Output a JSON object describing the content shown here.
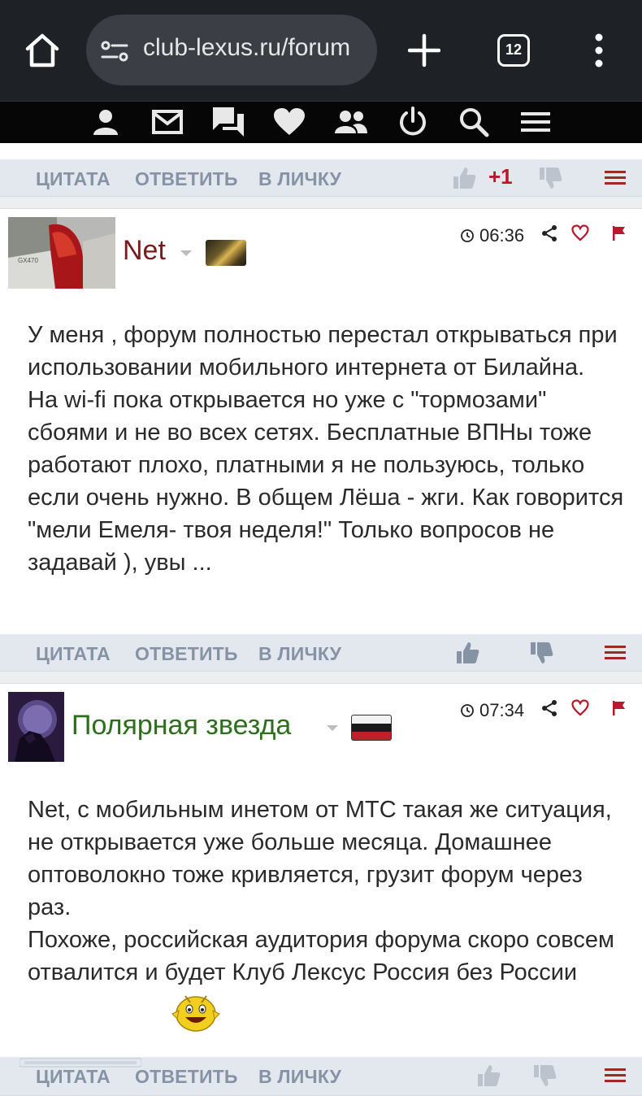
{
  "browser": {
    "url": "club-lexus.ru/forum",
    "tab_count": "12"
  },
  "post_bar_labels": {
    "quote": "ЦИТАТА",
    "reply": "ОТВЕТИТЬ",
    "pm": "В ЛИЧКУ"
  },
  "prev_post": {
    "score": "+1"
  },
  "posts": [
    {
      "author": "Net",
      "time": "06:36",
      "text": "У меня , форум полностью перестал открываться при использовании мобильного интернета от Билайна.\nНа wi-fi пока открывается но уже с \"тормозами\" сбоями и не во всех сетях. Бесплатные ВПНы тоже работают плохо, платными я не пользуюсь, только если очень нужно. В общем Лёша - жги. Как говорится \"мели Емеля- твоя неделя!\" Только вопросов не задавай ), увы ..."
    },
    {
      "author": "Полярная звезда",
      "time": "07:34",
      "text": "Net, с мобильным инетом от МТС такая же ситуация, не открывается уже больше месяца. Домашнее оптоволокно тоже кривляется, грузит форум через раз.\nПохоже, российская аудитория форума скоро совсем отвалится и будет Клуб Лексус Россия без России"
    }
  ],
  "colors": {
    "author_net": "#7a1a1a",
    "author_polar": "#2c6e1c",
    "accent_red": "#b7182b"
  },
  "icons": {
    "nav": [
      "user-icon",
      "mail-icon",
      "messages-icon",
      "heart-icon",
      "friends-icon",
      "power-icon",
      "search-icon",
      "menu-icon"
    ]
  }
}
